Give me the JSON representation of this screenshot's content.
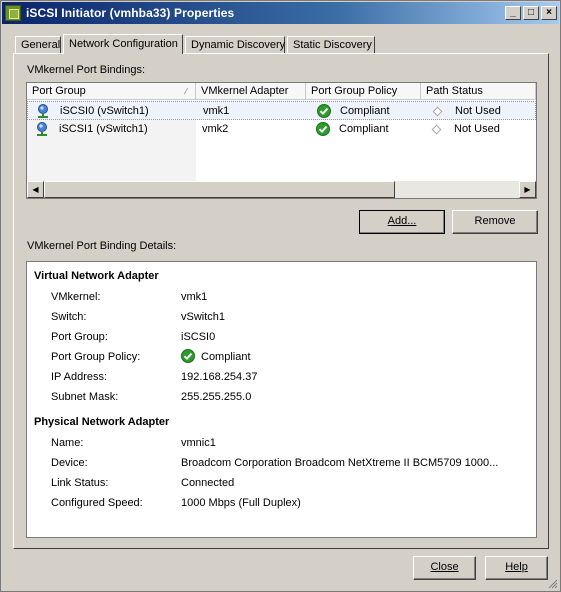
{
  "window": {
    "title": "iSCSI Initiator (vmhba33) Properties",
    "controls": {
      "minimize": "_",
      "maximize": "□",
      "close": "×"
    }
  },
  "tabs": [
    {
      "label": "General",
      "active": false
    },
    {
      "label": "Network Configuration",
      "active": true
    },
    {
      "label": "Dynamic Discovery",
      "active": false
    },
    {
      "label": "Static Discovery",
      "active": false
    }
  ],
  "bindings": {
    "section_label": "VMkernel Port Bindings:",
    "columns": [
      "Port Group",
      "VMkernel Adapter",
      "Port Group Policy",
      "Path Status"
    ],
    "rows": [
      {
        "port_group": "iSCSI0 (vSwitch1)",
        "adapter": "vmk1",
        "policy": "Compliant",
        "path_status": "Not Used"
      },
      {
        "port_group": "iSCSI1 (vSwitch1)",
        "adapter": "vmk2",
        "policy": "Compliant",
        "path_status": "Not Used"
      }
    ],
    "add_button": "Add...",
    "remove_button": "Remove"
  },
  "details": {
    "section_label": "VMkernel Port Binding Details:",
    "virtual": {
      "heading": "Virtual Network Adapter",
      "fields": [
        {
          "label": "VMkernel:",
          "value": "vmk1"
        },
        {
          "label": "Switch:",
          "value": "vSwitch1"
        },
        {
          "label": "Port Group:",
          "value": "iSCSI0"
        },
        {
          "label": "Port Group Policy:",
          "value": "Compliant"
        },
        {
          "label": "IP Address:",
          "value": "192.168.254.37"
        },
        {
          "label": "Subnet Mask:",
          "value": "255.255.255.0"
        }
      ]
    },
    "physical": {
      "heading": "Physical Network Adapter",
      "fields": [
        {
          "label": "Name:",
          "value": "vmnic1"
        },
        {
          "label": "Device:",
          "value": "Broadcom Corporation Broadcom NetXtreme II BCM5709 1000..."
        },
        {
          "label": "Link Status:",
          "value": "Connected"
        },
        {
          "label": "Configured Speed:",
          "value": "1000 Mbps (Full Duplex)"
        }
      ]
    }
  },
  "footer": {
    "close_button": "Close",
    "help_button": "Help"
  },
  "colors": {
    "ok_green": "#2e9b2e",
    "title_blue": "#0a246a",
    "selection_border": "#7f9bc9"
  },
  "icons": [
    "app-icon",
    "network-port-icon",
    "check-circle-icon",
    "diamond-icon",
    "resize-grip-icon"
  ]
}
